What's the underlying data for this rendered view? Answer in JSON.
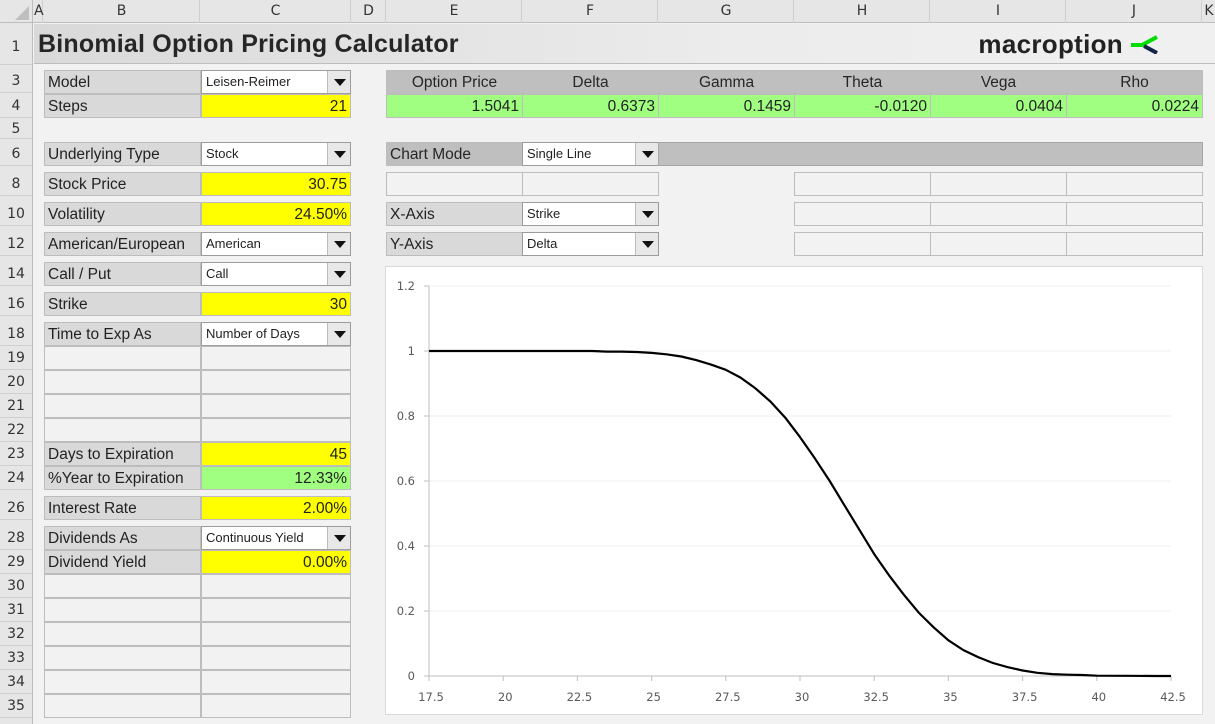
{
  "columns": [
    "A",
    "B",
    "C",
    "D",
    "E",
    "F",
    "G",
    "H",
    "I",
    "J",
    "K"
  ],
  "rows": [
    "1",
    "3",
    "4",
    "5",
    "6",
    "8",
    "10",
    "12",
    "14",
    "16",
    "18",
    "19",
    "20",
    "21",
    "22",
    "23",
    "24",
    "26",
    "28",
    "29",
    "30",
    "31",
    "32",
    "33",
    "34",
    "35"
  ],
  "title": "Binomial Option Pricing Calculator",
  "brand": {
    "name": "macroption",
    "mark_colors": {
      "green": "#00dd00",
      "navy": "#14264a"
    }
  },
  "inputs": {
    "model": {
      "label": "Model",
      "value": "Leisen-Reimer"
    },
    "steps": {
      "label": "Steps",
      "value": "21"
    },
    "underlying_type": {
      "label": "Underlying Type",
      "value": "Stock"
    },
    "stock_price": {
      "label": "Stock Price",
      "value": "30.75"
    },
    "volatility": {
      "label": "Volatility",
      "value": "24.50%"
    },
    "american_european": {
      "label": "American/European",
      "value": "American"
    },
    "call_put": {
      "label": "Call / Put",
      "value": "Call"
    },
    "strike": {
      "label": "Strike",
      "value": "30"
    },
    "time_to_exp_as": {
      "label": "Time to Exp As",
      "value": "Number of Days"
    },
    "days_to_expiration": {
      "label": "Days to Expiration",
      "value": "45"
    },
    "pct_year_to_expiration": {
      "label": "%Year to Expiration",
      "value": "12.33%"
    },
    "interest_rate": {
      "label": "Interest Rate",
      "value": "2.00%"
    },
    "dividends_as": {
      "label": "Dividends As",
      "value": "Continuous Yield"
    },
    "dividend_yield": {
      "label": "Dividend Yield",
      "value": "0.00%"
    }
  },
  "results": {
    "headers": [
      "Option Price",
      "Delta",
      "Gamma",
      "Theta",
      "Vega",
      "Rho"
    ],
    "values": [
      "1.5041",
      "0.6373",
      "0.1459",
      "-0.0120",
      "0.0404",
      "0.0224"
    ]
  },
  "chart_controls": {
    "chart_mode": {
      "label": "Chart Mode",
      "value": "Single Line"
    },
    "x_axis": {
      "label": "X-Axis",
      "value": "Strike"
    },
    "y_axis": {
      "label": "Y-Axis",
      "value": "Delta"
    }
  },
  "colors": {
    "input_yellow": "#ffff00",
    "output_green": "#a0ff80",
    "label_gray": "#d9d9d9",
    "header_gray": "#bfbfbf"
  },
  "chart_data": {
    "type": "line",
    "title": "",
    "xlabel": "",
    "ylabel": "",
    "xlim": [
      17.5,
      42.5
    ],
    "ylim": [
      0,
      1.2
    ],
    "x_ticks": [
      "17.5",
      "20",
      "22.5",
      "25",
      "27.5",
      "30",
      "32.5",
      "35",
      "37.5",
      "40",
      "42.5"
    ],
    "y_ticks": [
      "0",
      "0.2",
      "0.4",
      "0.6",
      "0.8",
      "1",
      "1.2"
    ],
    "grid": true,
    "legend": "none",
    "series": [
      {
        "name": "Delta",
        "color": "#000000",
        "x": [
          17.5,
          18,
          19,
          20,
          21,
          22,
          23,
          23.5,
          24,
          24.5,
          25,
          25.5,
          26,
          26.5,
          27,
          27.5,
          28,
          28.5,
          29,
          29.5,
          30,
          30.5,
          31,
          31.5,
          32,
          32.5,
          33,
          33.5,
          34,
          34.5,
          35,
          35.5,
          36,
          36.5,
          37,
          37.5,
          38,
          38.5,
          39,
          39.5,
          40,
          41,
          42,
          42.5
        ],
        "y": [
          1.0,
          1.0,
          1.0,
          1.0,
          1.0,
          1.0,
          1.0,
          0.998,
          0.998,
          0.997,
          0.994,
          0.99,
          0.983,
          0.972,
          0.958,
          0.942,
          0.918,
          0.885,
          0.845,
          0.795,
          0.735,
          0.67,
          0.6,
          0.525,
          0.45,
          0.375,
          0.31,
          0.25,
          0.195,
          0.15,
          0.11,
          0.08,
          0.058,
          0.04,
          0.027,
          0.017,
          0.01,
          0.006,
          0.004,
          0.003,
          0.001,
          0.0005,
          0.0,
          0.0
        ]
      }
    ]
  }
}
